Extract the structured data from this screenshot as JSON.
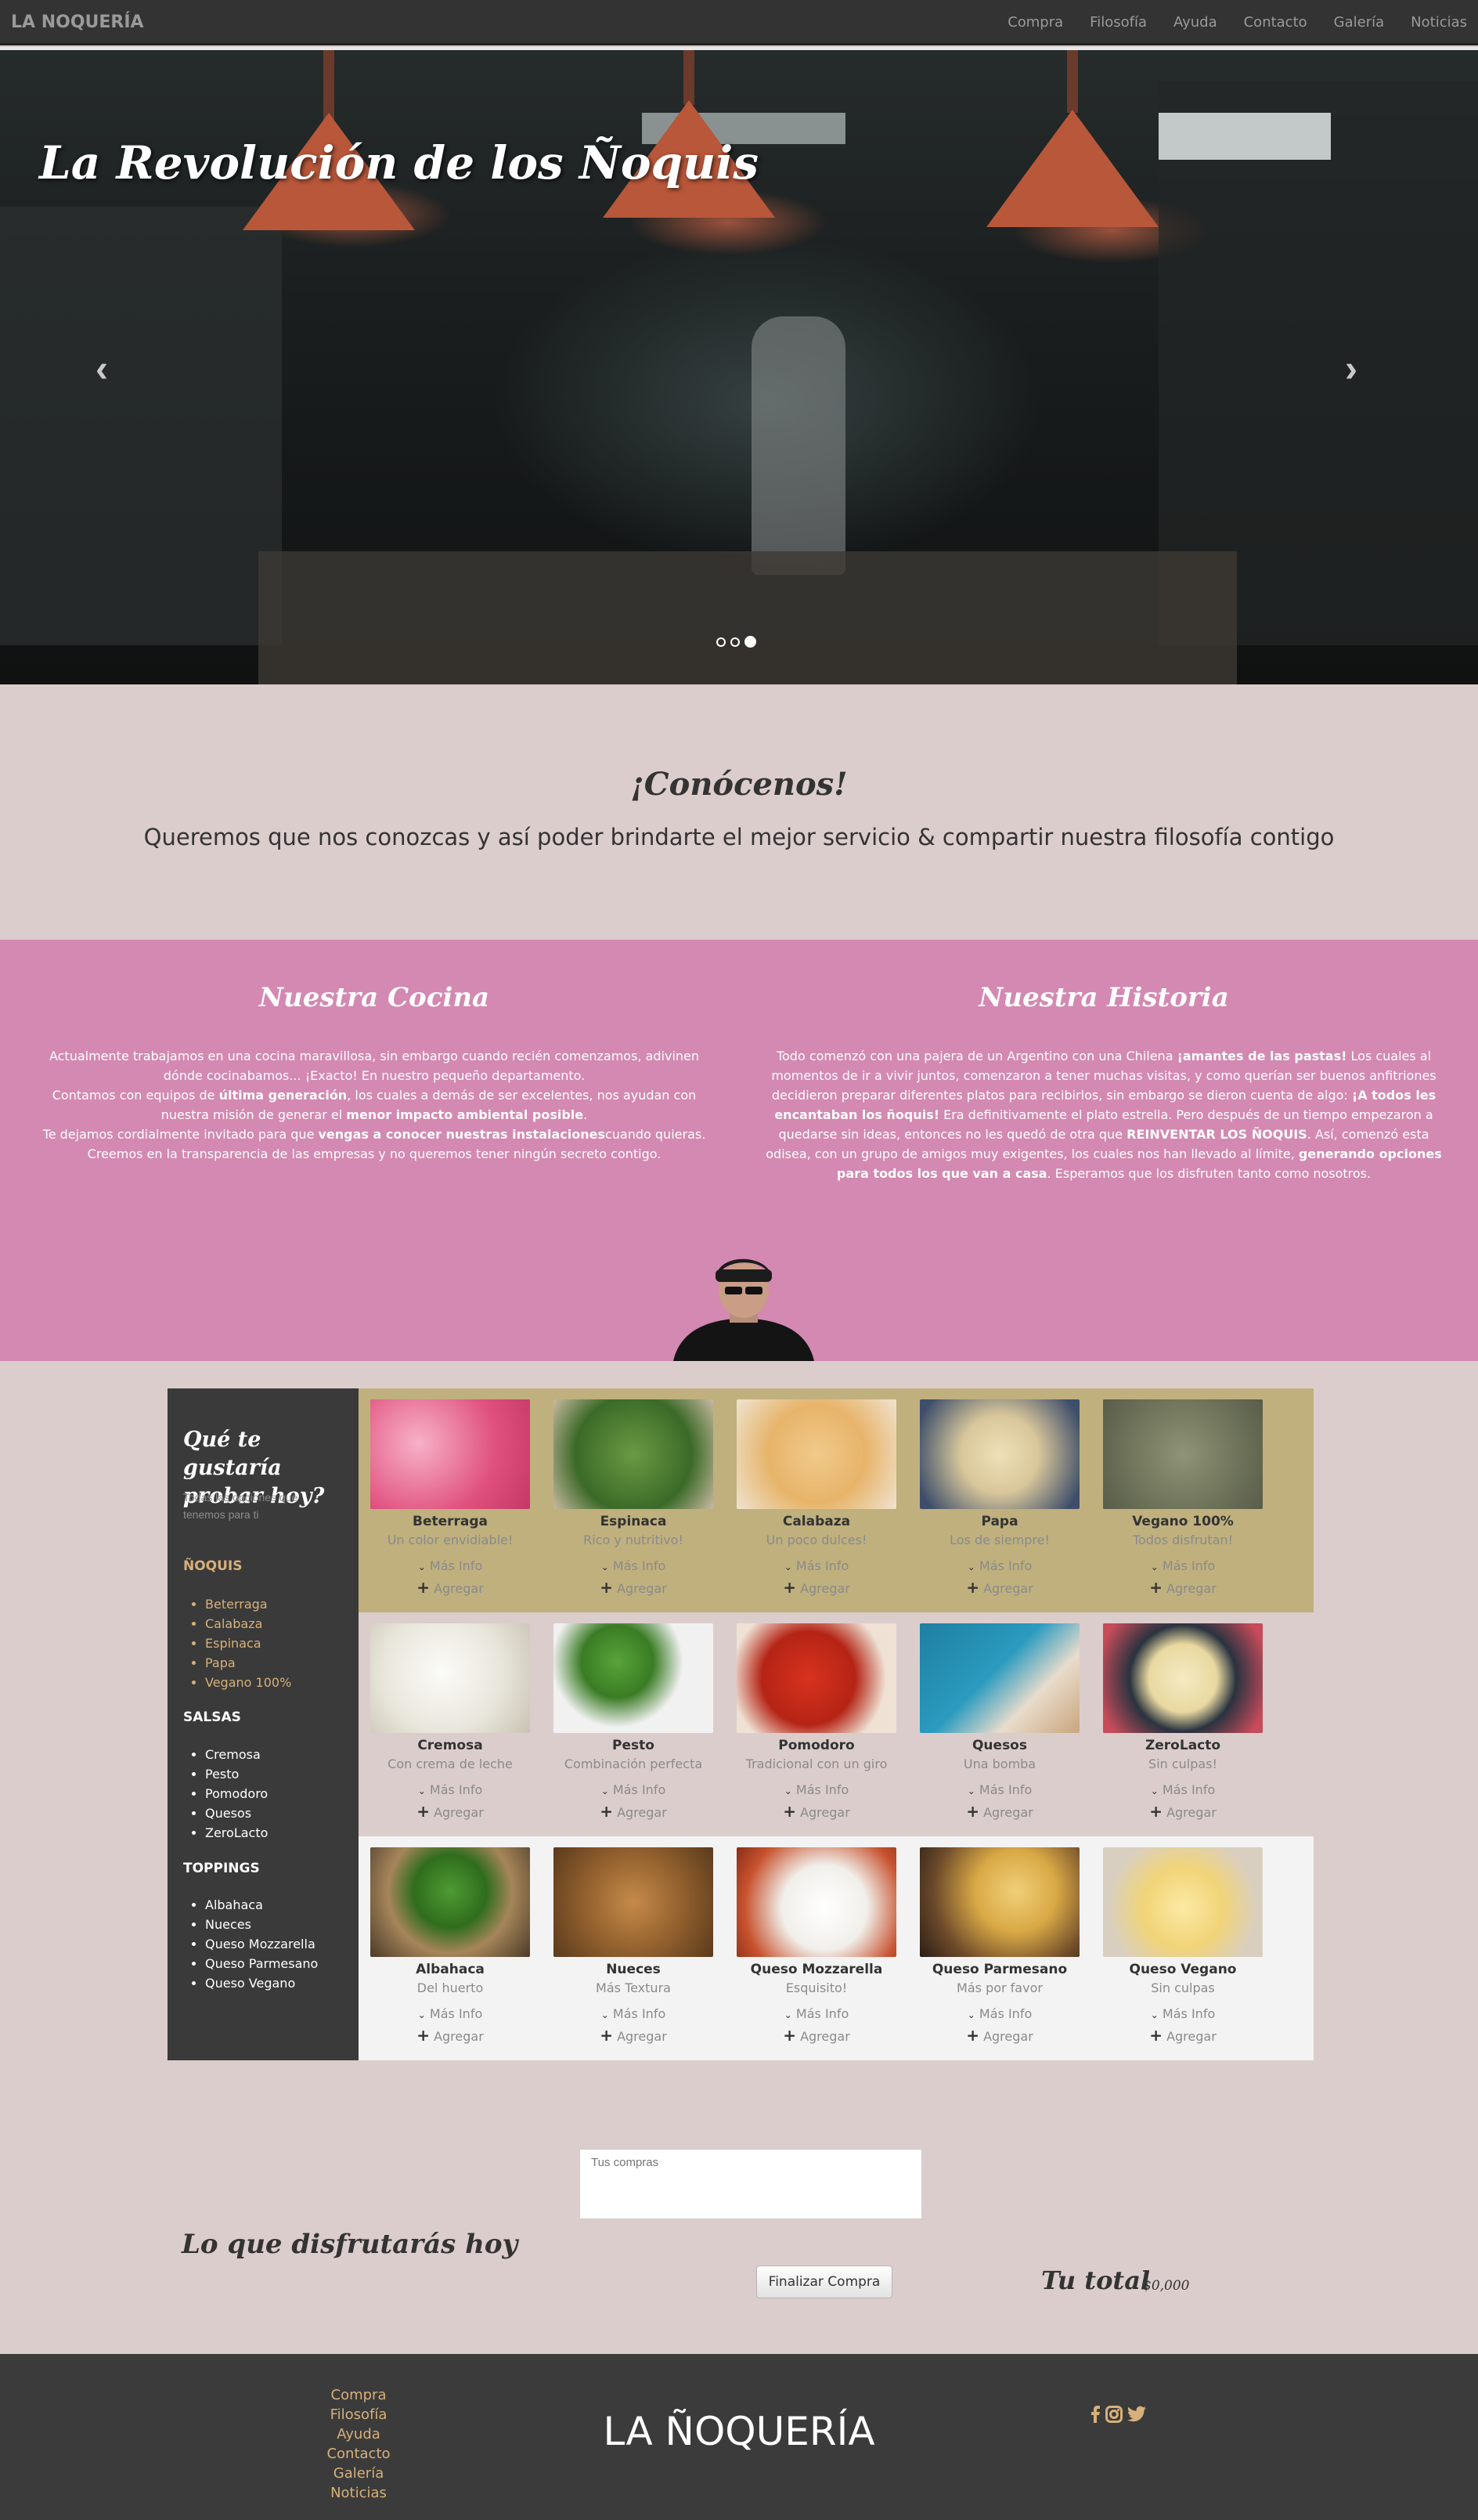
{
  "nav": {
    "brand": "LA NOQUERÍA",
    "links": [
      "Compra",
      "Filosofía",
      "Ayuda",
      "Contacto",
      "Galería",
      "Noticias"
    ]
  },
  "hero": {
    "title": "La Revolución de los Ñoquis",
    "prev": "‹",
    "next": "›",
    "slides": 3,
    "active_slide": 3
  },
  "about": {
    "title": "¡Conócenos!",
    "subtitle": "Queremos que nos conozcas y así poder brindarte el mejor servicio & compartir nuestra filosofía contigo"
  },
  "cocina": {
    "title": "Nuestra Cocina",
    "p1": "Actualmente trabajamos en una cocina maravillosa, sin embargo cuando recién comenzamos, adivinen dónde cocinabamos... ¡Exacto! En nuestro pequeño departamento.",
    "p2a": "Contamos con equipos de ",
    "p2b": "última generación",
    "p2c": ", los cuales a demás de ser excelentes, nos ayudan con nuestra misión de generar el ",
    "p2d": "menor impacto ambiental posible",
    "p2e": ".",
    "p3a": "Te dejamos cordialmente invitado para que ",
    "p3b": "vengas a conocer nuestras instalaciones",
    "p3c": "cuando quieras. Creemos en la transparencia de las empresas y no queremos tener ningún secreto contigo."
  },
  "historia": {
    "title": "Nuestra Historia",
    "a": "Todo comenzó con una pajera de un Argentino con una Chilena ",
    "b": "¡amantes de las pastas!",
    "c": " Los cuales al momentos de ir a vivir juntos, comenzaron a tener muchas visitas, y como querían ser buenos anfitriones decidieron preparar diferentes platos para recibirlos, sin embargo se dieron cuenta de algo: ",
    "d": "¡A todos les encantaban los ñoquis!",
    "e": " Era definitivamente el plato estrella. Pero después de un tiempo empezaron a quedarse sin ideas, entonces no les quedó de otra que ",
    "f": "REINVENTAR LOS ÑOQUIS",
    "g": ". Así, comenzó esta odisea, con un grupo de amigos muy exigentes, los cuales nos han llevado al límite, ",
    "h": "generando opciones para todos los que van a casa",
    "i": ". Esperamos que los disfruten tanto como nosotros."
  },
  "sidebar": {
    "question": "Qué te gustaría probar hoy?",
    "sub": "Todas las opciones que tenemos para ti",
    "categories": [
      {
        "title": "ÑOQUIS",
        "items": [
          "Beterraga",
          "Calabaza",
          "Espinaca",
          "Papa",
          "Vegano 100%"
        ]
      },
      {
        "title": "SALSAS",
        "items": [
          "Cremosa",
          "Pesto",
          "Pomodoro",
          "Quesos",
          "ZeroLacto"
        ]
      },
      {
        "title": "TOPPINGS",
        "items": [
          "Albahaca",
          "Nueces",
          "Queso Mozzarella",
          "Queso Parmesano",
          "Queso Vegano"
        ]
      }
    ]
  },
  "products": {
    "more_label": "Más Info",
    "add_label": "Agregar",
    "rows": [
      [
        {
          "name": "Beterraga",
          "desc": "Un color envidiable!",
          "icon": "pink-gnocchi-image"
        },
        {
          "name": "Espinaca",
          "desc": "Rico y nutritivo!",
          "icon": "green-gnocchi-image"
        },
        {
          "name": "Calabaza",
          "desc": "Un poco dulces!",
          "icon": "orange-gnocchi-image"
        },
        {
          "name": "Papa",
          "desc": "Los de siempre!",
          "icon": "potato-gnocchi-image"
        },
        {
          "name": "Vegano 100%",
          "desc": "Todos disfrutan!",
          "icon": "vegan-gnocchi-image"
        }
      ],
      [
        {
          "name": "Cremosa",
          "desc": "Con crema de leche",
          "icon": "cream-sauce-image"
        },
        {
          "name": "Pesto",
          "desc": "Combinación perfecta",
          "icon": "pesto-image"
        },
        {
          "name": "Pomodoro",
          "desc": "Tradicional con un giro",
          "icon": "tomato-sauce-image"
        },
        {
          "name": "Quesos",
          "desc": "Una bomba",
          "icon": "cheese-sauce-image"
        },
        {
          "name": "ZeroLacto",
          "desc": "Sin culpas!",
          "icon": "dairy-free-sauce-image"
        }
      ],
      [
        {
          "name": "Albahaca",
          "desc": "Del huerto",
          "icon": "basil-image"
        },
        {
          "name": "Nueces",
          "desc": "Más Textura",
          "icon": "walnuts-image"
        },
        {
          "name": "Queso Mozzarella",
          "desc": "Esquisito!",
          "icon": "mozzarella-image"
        },
        {
          "name": "Queso Parmesano",
          "desc": "Más por favor",
          "icon": "parmesan-image"
        },
        {
          "name": "Queso Vegano",
          "desc": "Sin culpas",
          "icon": "vegan-cheese-image"
        }
      ]
    ]
  },
  "order": {
    "textarea_placeholder": "Tus compras",
    "heading": "Lo que disfrutarás hoy",
    "button": "Finalizar Compra",
    "total_label": "Tu total",
    "total_value": "$0,000"
  },
  "footer": {
    "links": [
      "Compra",
      "Filosofía",
      "Ayuda",
      "Contacto",
      "Galería",
      "Noticias"
    ],
    "brand": "LA ÑOQUERÍA",
    "social": [
      "facebook-icon",
      "instagram-icon",
      "twitter-icon"
    ]
  },
  "colors": {
    "accent_gold": "#d7b07a",
    "pink_section": "#d389b1",
    "bg_beige": "#dccdcd",
    "dark": "#3a3a3a"
  }
}
